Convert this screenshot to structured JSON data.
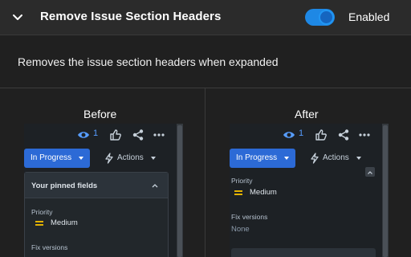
{
  "header": {
    "title": "Remove Issue Section Headers",
    "toggle_label": "Enabled",
    "toggle_on": true
  },
  "description": "Removes the issue section headers when expanded",
  "before": {
    "title": "Before",
    "watch_count": "1",
    "status_button": "In Progress",
    "actions_button": "Actions",
    "pinned_header": "Your pinned fields",
    "priority_label": "Priority",
    "priority_value": "Medium",
    "fix_versions_label": "Fix versions"
  },
  "after": {
    "title": "After",
    "watch_count": "1",
    "status_button": "In Progress",
    "actions_button": "Actions",
    "priority_label": "Priority",
    "priority_value": "Medium",
    "fix_versions_label": "Fix versions",
    "fix_versions_value": "None"
  },
  "colors": {
    "accent": "#2c6ad6",
    "toggle": "#1e88e5",
    "priority_medium": "#e2b203"
  }
}
